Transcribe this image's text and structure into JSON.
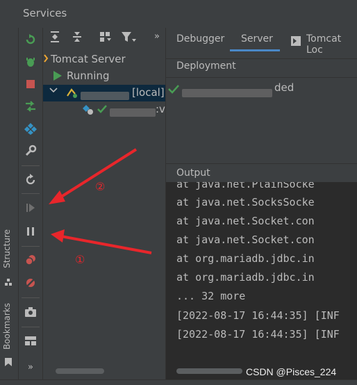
{
  "window": {
    "title": "Services"
  },
  "side_strip": {
    "structure_label": "Structure",
    "bookmarks_label": "Bookmarks",
    "more_label": "»"
  },
  "tree_toolbar": {
    "more_label": "»"
  },
  "tree": {
    "server": "Tomcat Server",
    "status": "Running",
    "instance_suffix": "[local]",
    "artifact_suffix": ":v"
  },
  "tabs": [
    {
      "label": "Debugger"
    },
    {
      "label": "Server"
    },
    {
      "label": "Tomcat Loc"
    }
  ],
  "deployment": {
    "header": "Deployment",
    "status_suffix": "ded"
  },
  "output": {
    "header": "Output",
    "lines": [
      "   at java.net.PlainSocke",
      "   at java.net.SocksSocke",
      "   at java.net.Socket.con",
      "   at java.net.Socket.con",
      "   at org.mariadb.jdbc.in",
      "   at org.mariadb.jdbc.in",
      "   ... 32 more",
      "[2022-08-17 16:44:35] [INF",
      "[2022-08-17 16:44:35] [INF"
    ]
  },
  "annotations": {
    "label_1": "①",
    "label_2": "②",
    "arrow_color": "#e8262b"
  },
  "watermark": "CSDN @Pisces_224",
  "colors": {
    "run_green": "#499c54",
    "stop_red": "#c75450",
    "accent_blue": "#3592c4",
    "sel_blue": "#0d293e"
  }
}
